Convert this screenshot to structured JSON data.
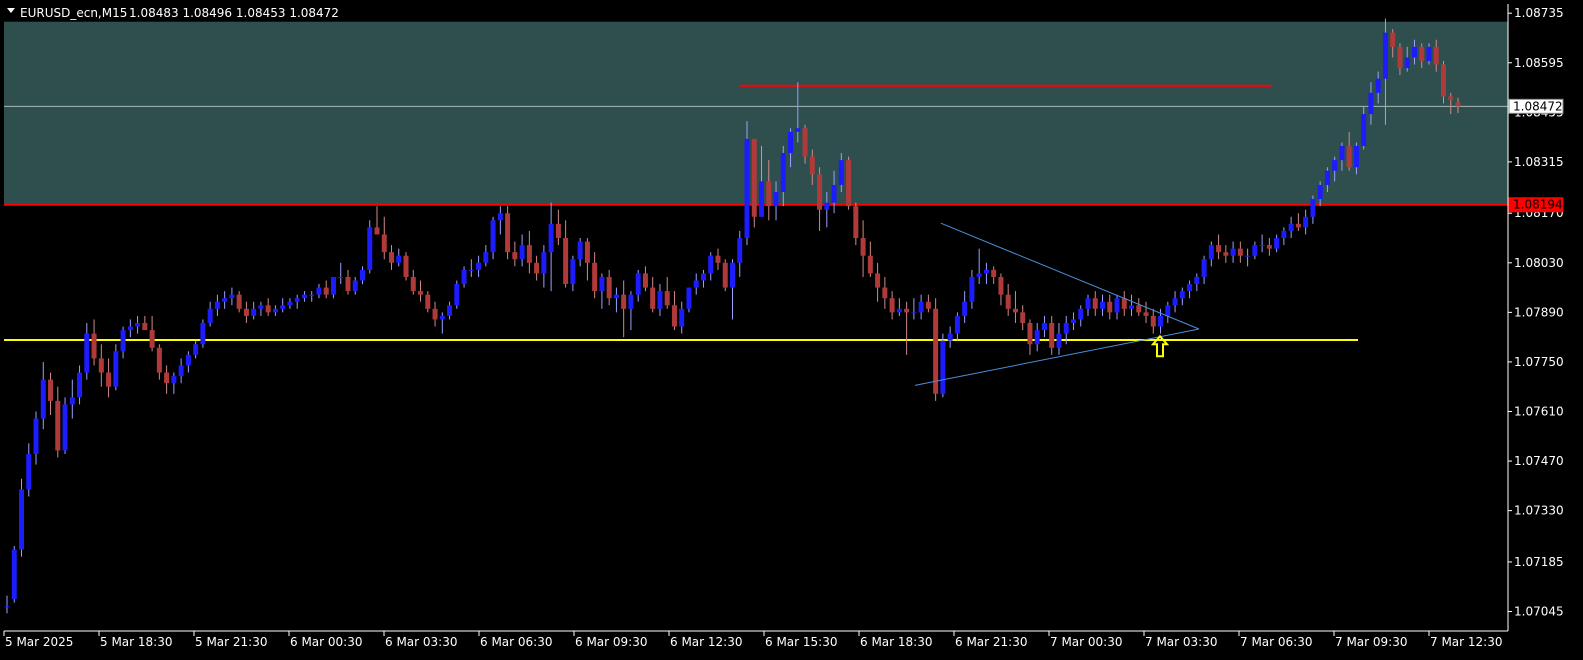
{
  "header": {
    "symbol": "EURUSD_ecn,M15",
    "ohlc": "1.08483 1.08496 1.08453 1.08472"
  },
  "colors": {
    "background": "#000000",
    "bull": "#1c1cff",
    "bear": "#b03a3a",
    "wick": "#dddddd",
    "zone": "#2f4f4f",
    "resistance": "#ff0000",
    "support": "#ffff00",
    "triangle": "#4a90d9",
    "current_line": "#a8b8b8",
    "arrow": "#ffff00",
    "axis": "#ffffff"
  },
  "chart_data": {
    "type": "candlestick",
    "symbol": "EURUSD_ecn",
    "timeframe": "M15",
    "ylim": [
      1.0699,
      1.08761
    ],
    "y_ticks": [
      "1.08735",
      "1.08595",
      "1.08455",
      "1.08315",
      "1.08170",
      "1.08030",
      "1.07890",
      "1.07750",
      "1.07610",
      "1.07470",
      "1.07330",
      "1.07185",
      "1.07045"
    ],
    "x_ticks": [
      "5 Mar 2025",
      "5 Mar 18:30",
      "5 Mar 21:30",
      "6 Mar 00:30",
      "6 Mar 03:30",
      "6 Mar 06:30",
      "6 Mar 09:30",
      "6 Mar 12:30",
      "6 Mar 15:30",
      "6 Mar 18:30",
      "6 Mar 21:30",
      "7 Mar 00:30",
      "7 Mar 03:30",
      "7 Mar 06:30",
      "7 Mar 09:30",
      "7 Mar 12:30"
    ],
    "current_price": "1.08472",
    "current_price_value": 1.08472,
    "price_labels": [
      {
        "text": "1.08472",
        "value": 1.08472,
        "style": "current"
      },
      {
        "text": "1.08194",
        "value": 1.08194,
        "style": "resistance"
      }
    ],
    "zone": {
      "top": 1.08711,
      "bottom": 1.08194
    },
    "resistance_level": 1.08194,
    "support_level": 1.07812,
    "short_level": {
      "price": 1.0853,
      "from_bar": 101,
      "to_bar": 158
    },
    "triangle": {
      "upper_start": {
        "bar": 117,
        "price": 1.0793
      },
      "lower_start": {
        "bar": 114,
        "price": 1.0765
      },
      "apex": {
        "bar": 149,
        "price": 1.0786
      }
    },
    "arrow": {
      "bar": 144,
      "price": 1.078
    },
    "ohlc": [
      [
        1.0706,
        1.0709,
        1.0704,
        1.0706
      ],
      [
        1.0708,
        1.0723,
        1.0707,
        1.0722
      ],
      [
        1.0722,
        1.0742,
        1.072,
        1.0739
      ],
      [
        1.0739,
        1.0752,
        1.0737,
        1.0749
      ],
      [
        1.0749,
        1.0761,
        1.0746,
        1.0759
      ],
      [
        1.0759,
        1.0775,
        1.0756,
        1.077
      ],
      [
        1.077,
        1.0772,
        1.076,
        1.0764
      ],
      [
        1.0764,
        1.0768,
        1.0748,
        1.075
      ],
      [
        1.075,
        1.0765,
        1.0749,
        1.0763
      ],
      [
        1.0763,
        1.077,
        1.0759,
        1.0765
      ],
      [
        1.0765,
        1.0774,
        1.0763,
        1.0772
      ],
      [
        1.0772,
        1.0786,
        1.077,
        1.0783
      ],
      [
        1.0783,
        1.0787,
        1.0774,
        1.0776
      ],
      [
        1.0776,
        1.078,
        1.0768,
        1.0772
      ],
      [
        1.0772,
        1.0776,
        1.0765,
        1.0768
      ],
      [
        1.0768,
        1.078,
        1.0767,
        1.0778
      ],
      [
        1.0778,
        1.0785,
        1.0776,
        1.0784
      ],
      [
        1.0784,
        1.0787,
        1.0782,
        1.0785
      ],
      [
        1.0785,
        1.0788,
        1.0783,
        1.0786
      ],
      [
        1.0786,
        1.0788,
        1.0784,
        1.0784
      ],
      [
        1.0784,
        1.0788,
        1.0778,
        1.0779
      ],
      [
        1.0779,
        1.078,
        1.077,
        1.0772
      ],
      [
        1.0772,
        1.0774,
        1.0766,
        1.0769
      ],
      [
        1.0769,
        1.0772,
        1.0766,
        1.0771
      ],
      [
        1.0771,
        1.0776,
        1.0769,
        1.0774
      ],
      [
        1.0774,
        1.0778,
        1.0772,
        1.0777
      ],
      [
        1.0777,
        1.0781,
        1.0776,
        1.078
      ],
      [
        1.078,
        1.0787,
        1.0779,
        1.0786
      ],
      [
        1.0786,
        1.0792,
        1.0785,
        1.079
      ],
      [
        1.079,
        1.0794,
        1.0788,
        1.0792
      ],
      [
        1.0792,
        1.0795,
        1.079,
        1.0793
      ],
      [
        1.0793,
        1.0796,
        1.0791,
        1.0794
      ],
      [
        1.0794,
        1.0795,
        1.0789,
        1.079
      ],
      [
        1.079,
        1.0792,
        1.0786,
        1.0788
      ],
      [
        1.0788,
        1.0792,
        1.0787,
        1.079
      ],
      [
        1.079,
        1.0792,
        1.0788,
        1.0791
      ],
      [
        1.0791,
        1.0793,
        1.0788,
        1.0789
      ],
      [
        1.0789,
        1.0791,
        1.0788,
        1.079
      ],
      [
        1.079,
        1.0793,
        1.0789,
        1.0791
      ],
      [
        1.0791,
        1.0793,
        1.079,
        1.0792
      ],
      [
        1.0792,
        1.0794,
        1.079,
        1.0793
      ],
      [
        1.0793,
        1.0795,
        1.0792,
        1.0794
      ],
      [
        1.0794,
        1.0795,
        1.0792,
        1.0794
      ],
      [
        1.0794,
        1.0797,
        1.0793,
        1.0796
      ],
      [
        1.0796,
        1.0798,
        1.0793,
        1.0794
      ],
      [
        1.0794,
        1.0799,
        1.0793,
        1.0799
      ],
      [
        1.0799,
        1.0803,
        1.0797,
        1.0799
      ],
      [
        1.0799,
        1.0801,
        1.0794,
        1.0795
      ],
      [
        1.0795,
        1.0799,
        1.0794,
        1.0798
      ],
      [
        1.0798,
        1.0802,
        1.0797,
        1.0801
      ],
      [
        1.0801,
        1.0815,
        1.08,
        1.0813
      ],
      [
        1.0813,
        1.0819,
        1.0811,
        1.0811
      ],
      [
        1.0811,
        1.0816,
        1.0804,
        1.0806
      ],
      [
        1.0806,
        1.0808,
        1.0801,
        1.0803
      ],
      [
        1.0803,
        1.0807,
        1.0802,
        1.0805
      ],
      [
        1.0805,
        1.0806,
        1.0798,
        1.0799
      ],
      [
        1.0799,
        1.0801,
        1.0794,
        1.0795
      ],
      [
        1.0795,
        1.0798,
        1.0792,
        1.0794
      ],
      [
        1.0794,
        1.0795,
        1.0789,
        1.079
      ],
      [
        1.079,
        1.0792,
        1.0785,
        1.0787
      ],
      [
        1.0787,
        1.0789,
        1.0783,
        1.0788
      ],
      [
        1.0788,
        1.0792,
        1.0787,
        1.0791
      ],
      [
        1.0791,
        1.0798,
        1.079,
        1.0797
      ],
      [
        1.0797,
        1.0802,
        1.0796,
        1.0801
      ],
      [
        1.0801,
        1.0804,
        1.0799,
        1.0801
      ],
      [
        1.0801,
        1.0805,
        1.0799,
        1.0803
      ],
      [
        1.0803,
        1.0808,
        1.0802,
        1.0806
      ],
      [
        1.0806,
        1.0816,
        1.0804,
        1.0815
      ],
      [
        1.0815,
        1.0819,
        1.0811,
        1.0817
      ],
      [
        1.0817,
        1.0819,
        1.0804,
        1.0806
      ],
      [
        1.0806,
        1.0809,
        1.0802,
        1.0804
      ],
      [
        1.0804,
        1.0811,
        1.0802,
        1.0808
      ],
      [
        1.0808,
        1.0812,
        1.08,
        1.0803
      ],
      [
        1.0803,
        1.0805,
        1.0798,
        1.08
      ],
      [
        1.08,
        1.0808,
        1.0796,
        1.0806
      ],
      [
        1.0806,
        1.082,
        1.0795,
        1.0814
      ],
      [
        1.0814,
        1.0818,
        1.0808,
        1.081
      ],
      [
        1.081,
        1.0815,
        1.0796,
        1.0797
      ],
      [
        1.0797,
        1.0805,
        1.0795,
        1.0804
      ],
      [
        1.0804,
        1.081,
        1.0802,
        1.0809
      ],
      [
        1.0809,
        1.081,
        1.0798,
        1.0803
      ],
      [
        1.0803,
        1.0806,
        1.0793,
        1.0795
      ],
      [
        1.0795,
        1.08,
        1.079,
        1.0799
      ],
      [
        1.0799,
        1.0801,
        1.0791,
        1.0793
      ],
      [
        1.0793,
        1.0796,
        1.0789,
        1.0794
      ],
      [
        1.0794,
        1.0798,
        1.0782,
        1.079
      ],
      [
        1.079,
        1.0795,
        1.0784,
        1.0794
      ],
      [
        1.0794,
        1.0801,
        1.0792,
        1.08
      ],
      [
        1.08,
        1.0802,
        1.0795,
        1.0796
      ],
      [
        1.0796,
        1.0799,
        1.0789,
        1.079
      ],
      [
        1.079,
        1.0797,
        1.0788,
        1.0795
      ],
      [
        1.0795,
        1.0799,
        1.079,
        1.0791
      ],
      [
        1.0791,
        1.0795,
        1.0784,
        1.0785
      ],
      [
        1.0785,
        1.0792,
        1.0783,
        1.079
      ],
      [
        1.079,
        1.0796,
        1.0789,
        1.0796
      ],
      [
        1.0796,
        1.08,
        1.0794,
        1.0798
      ],
      [
        1.0798,
        1.0801,
        1.0796,
        1.08
      ],
      [
        1.08,
        1.0806,
        1.0798,
        1.0805
      ],
      [
        1.0805,
        1.0807,
        1.0801,
        1.0803
      ],
      [
        1.0803,
        1.0804,
        1.0795,
        1.0796
      ],
      [
        1.0796,
        1.0804,
        1.0787,
        1.0803
      ],
      [
        1.0803,
        1.0812,
        1.0799,
        1.081
      ],
      [
        1.081,
        1.0843,
        1.0808,
        1.0838
      ],
      [
        1.0838,
        1.083,
        1.0813,
        1.0816
      ],
      [
        1.0816,
        1.0836,
        1.0816,
        1.0826
      ],
      [
        1.0826,
        1.0832,
        1.0815,
        1.0819
      ],
      [
        1.0819,
        1.0826,
        1.0815,
        1.0823
      ],
      [
        1.0823,
        1.0836,
        1.0819,
        1.0834
      ],
      [
        1.0834,
        1.0841,
        1.083,
        1.084
      ],
      [
        1.084,
        1.0854,
        1.0837,
        1.0841
      ],
      [
        1.0841,
        1.0842,
        1.0831,
        1.0833
      ],
      [
        1.0833,
        1.0835,
        1.0825,
        1.0828
      ],
      [
        1.0828,
        1.083,
        1.0812,
        1.0818
      ],
      [
        1.0818,
        1.0823,
        1.0813,
        1.082
      ],
      [
        1.082,
        1.0829,
        1.0817,
        1.0825
      ],
      [
        1.0825,
        1.0834,
        1.0823,
        1.0832
      ],
      [
        1.0832,
        1.0833,
        1.0818,
        1.0819
      ],
      [
        1.0819,
        1.082,
        1.0808,
        1.081
      ],
      [
        1.081,
        1.0815,
        1.0799,
        1.0805
      ],
      [
        1.0805,
        1.0809,
        1.0799,
        1.08
      ],
      [
        1.08,
        1.0803,
        1.0792,
        1.0796
      ],
      [
        1.0796,
        1.0799,
        1.079,
        1.0793
      ],
      [
        1.0793,
        1.0795,
        1.0787,
        1.0789
      ],
      [
        1.0789,
        1.0793,
        1.0788,
        1.079
      ],
      [
        1.079,
        1.0792,
        1.0777,
        1.0789
      ],
      [
        1.0789,
        1.0793,
        1.0787,
        1.0789
      ],
      [
        1.0789,
        1.0794,
        1.0787,
        1.0792
      ],
      [
        1.0792,
        1.0794,
        1.0789,
        1.079
      ],
      [
        1.079,
        1.0793,
        1.0764,
        1.0766
      ],
      [
        1.0766,
        1.0783,
        1.0765,
        1.0781
      ],
      [
        1.0781,
        1.0785,
        1.0779,
        1.0783
      ],
      [
        1.0783,
        1.0789,
        1.0781,
        1.0788
      ],
      [
        1.0788,
        1.0795,
        1.0786,
        1.0792
      ],
      [
        1.0792,
        1.0801,
        1.079,
        1.0799
      ],
      [
        1.0799,
        1.0807,
        1.0797,
        1.08
      ],
      [
        1.08,
        1.0803,
        1.0797,
        1.0801
      ],
      [
        1.0801,
        1.0802,
        1.0797,
        1.0799
      ],
      [
        1.0799,
        1.08,
        1.0791,
        1.0794
      ],
      [
        1.0794,
        1.0797,
        1.0788,
        1.079
      ],
      [
        1.079,
        1.0795,
        1.0786,
        1.0789
      ],
      [
        1.0789,
        1.0791,
        1.0784,
        1.0786
      ],
      [
        1.0786,
        1.0787,
        1.0777,
        1.078
      ],
      [
        1.078,
        1.0786,
        1.0778,
        1.0784
      ],
      [
        1.0784,
        1.0788,
        1.0782,
        1.0786
      ],
      [
        1.0786,
        1.0788,
        1.0777,
        1.0779
      ],
      [
        1.0779,
        1.0786,
        1.0777,
        1.0783
      ],
      [
        1.0783,
        1.0788,
        1.078,
        1.0786
      ],
      [
        1.0786,
        1.0789,
        1.0784,
        1.0787
      ],
      [
        1.0787,
        1.0791,
        1.0785,
        1.079
      ],
      [
        1.079,
        1.0794,
        1.0788,
        1.0793
      ],
      [
        1.0793,
        1.0795,
        1.0788,
        1.079
      ],
      [
        1.079,
        1.0794,
        1.0788,
        1.0792
      ],
      [
        1.0792,
        1.0794,
        1.0787,
        1.0789
      ],
      [
        1.0789,
        1.0794,
        1.0787,
        1.0793
      ],
      [
        1.0793,
        1.0795,
        1.0788,
        1.079
      ],
      [
        1.079,
        1.0794,
        1.0788,
        1.0791
      ],
      [
        1.0791,
        1.0793,
        1.0788,
        1.0789
      ],
      [
        1.0789,
        1.0792,
        1.0786,
        1.0788
      ],
      [
        1.0788,
        1.079,
        1.0783,
        1.0785
      ],
      [
        1.0785,
        1.079,
        1.0783,
        1.0788
      ],
      [
        1.0788,
        1.0792,
        1.0786,
        1.0791
      ],
      [
        1.0791,
        1.0795,
        1.0789,
        1.0793
      ],
      [
        1.0793,
        1.0796,
        1.0791,
        1.0795
      ],
      [
        1.0795,
        1.0798,
        1.0793,
        1.0797
      ],
      [
        1.0797,
        1.08,
        1.0795,
        1.0799
      ],
      [
        1.0799,
        1.0805,
        1.0797,
        1.0804
      ],
      [
        1.0804,
        1.0809,
        1.0802,
        1.0808
      ],
      [
        1.0808,
        1.0811,
        1.0804,
        1.0806
      ],
      [
        1.0806,
        1.0808,
        1.0803,
        1.0805
      ],
      [
        1.0805,
        1.0809,
        1.0803,
        1.0807
      ],
      [
        1.0807,
        1.0809,
        1.0803,
        1.0805
      ],
      [
        1.0805,
        1.0807,
        1.0802,
        1.0805
      ],
      [
        1.0805,
        1.0809,
        1.0804,
        1.0808
      ],
      [
        1.0808,
        1.0811,
        1.0806,
        1.0808
      ],
      [
        1.0808,
        1.081,
        1.0805,
        1.0807
      ],
      [
        1.0807,
        1.0811,
        1.0806,
        1.081
      ],
      [
        1.081,
        1.0813,
        1.0808,
        1.0812
      ],
      [
        1.0812,
        1.0816,
        1.081,
        1.0814
      ],
      [
        1.0814,
        1.0817,
        1.0812,
        1.0813
      ],
      [
        1.0813,
        1.0818,
        1.0811,
        1.0816
      ],
      [
        1.0816,
        1.0822,
        1.0814,
        1.0821
      ],
      [
        1.0821,
        1.0826,
        1.0819,
        1.0825
      ],
      [
        1.0825,
        1.083,
        1.0823,
        1.0829
      ],
      [
        1.0829,
        1.0833,
        1.0826,
        1.0832
      ],
      [
        1.0832,
        1.0837,
        1.0829,
        1.0836
      ],
      [
        1.0836,
        1.084,
        1.0829,
        1.083
      ],
      [
        1.083,
        1.0837,
        1.0828,
        1.0836
      ],
      [
        1.0836,
        1.0847,
        1.0835,
        1.0845
      ],
      [
        1.0845,
        1.0854,
        1.0842,
        1.0851
      ],
      [
        1.0851,
        1.0857,
        1.0848,
        1.0855
      ],
      [
        1.0855,
        1.0872,
        1.0842,
        1.0868
      ],
      [
        1.0868,
        1.0869,
        1.0861,
        1.0864
      ],
      [
        1.0864,
        1.0865,
        1.0856,
        1.0858
      ],
      [
        1.0858,
        1.0864,
        1.0857,
        1.0861
      ],
      [
        1.0861,
        1.0866,
        1.0859,
        1.0864
      ],
      [
        1.0864,
        1.0865,
        1.0858,
        1.086
      ],
      [
        1.086,
        1.0865,
        1.0859,
        1.0864
      ],
      [
        1.0864,
        1.0866,
        1.0857,
        1.0859
      ],
      [
        1.0859,
        1.086,
        1.0848,
        1.085
      ],
      [
        1.085,
        1.0851,
        1.0845,
        1.0849
      ],
      [
        1.08483,
        1.08496,
        1.08453,
        1.08472
      ]
    ]
  }
}
